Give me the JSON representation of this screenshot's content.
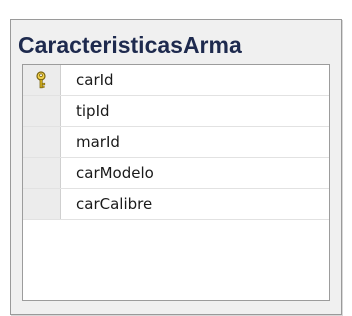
{
  "table": {
    "title": "CaracteristicasArma",
    "columns": [
      {
        "name": "carId",
        "primary_key": true
      },
      {
        "name": "tipId",
        "primary_key": false
      },
      {
        "name": "marId",
        "primary_key": false
      },
      {
        "name": "carModelo",
        "primary_key": false
      },
      {
        "name": "carCalibre",
        "primary_key": false
      }
    ]
  },
  "icons": {
    "primary_key": "key-icon"
  },
  "colors": {
    "title": "#1e2a4e",
    "key": "#d4b21a"
  }
}
